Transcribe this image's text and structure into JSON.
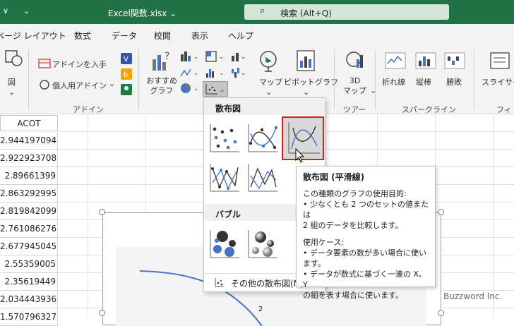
{
  "titlebar": {
    "title": "Excel関数.xlsx",
    "title_caret": "⌄",
    "search_placeholder": "検索 (Alt+Q)"
  },
  "menu": [
    "ページ レイアウト",
    "数式",
    "データ",
    "校閲",
    "表示",
    "ヘルプ"
  ],
  "ribbon": {
    "fig_label": "図",
    "addin_get": "アドインを入手",
    "addin_personal": "個人用アドイン",
    "addin_group": "アドイン",
    "recommended": "おすすめ\nグラフ",
    "map": "マップ",
    "pivot": "ピボットグラフ",
    "map3d": "3D\nマップ",
    "tour_group": "ツアー",
    "spark_line": "折れ線",
    "spark_column": "縦棒",
    "spark_winloss": "勝敗",
    "spark_group": "スパークライン",
    "slicer": "スライサー",
    "filter_group": "フィル"
  },
  "sheet": {
    "column_header": "ACOT",
    "values": [
      "2.944197094",
      "2.922923708",
      "2.89661399",
      "2.863292995",
      "2.819842099",
      "2.761086276",
      "2.677945045",
      "2.55359005",
      "2.35619449",
      "2.034443936",
      "1.570796327"
    ]
  },
  "chart": {
    "axis_tick": "2",
    "line_color": "#4472c4"
  },
  "dropdown": {
    "scatter_heading": "散布図",
    "bubble_heading": "バブル",
    "more_scatter": "その他の散布図(M)...",
    "selected_color": "#e01b1b"
  },
  "tooltip": {
    "title": "散布図 (平滑線)",
    "purpose_heading": "この種類のグラフの使用目的:",
    "purpose_line1": "• 少なくとも 2 つのセットの値または",
    "purpose_line2": "2 組のデータを比較します。",
    "use_heading": "使用ケース:",
    "use_line1": "• データ要素の数が多い場合に使い",
    "use_line2": "ます。",
    "use_line3": "• データが数式に基づく一連の X、Y",
    "use_line4": "の組を表す場合に使います。"
  },
  "watermark": "Buzzword Inc."
}
